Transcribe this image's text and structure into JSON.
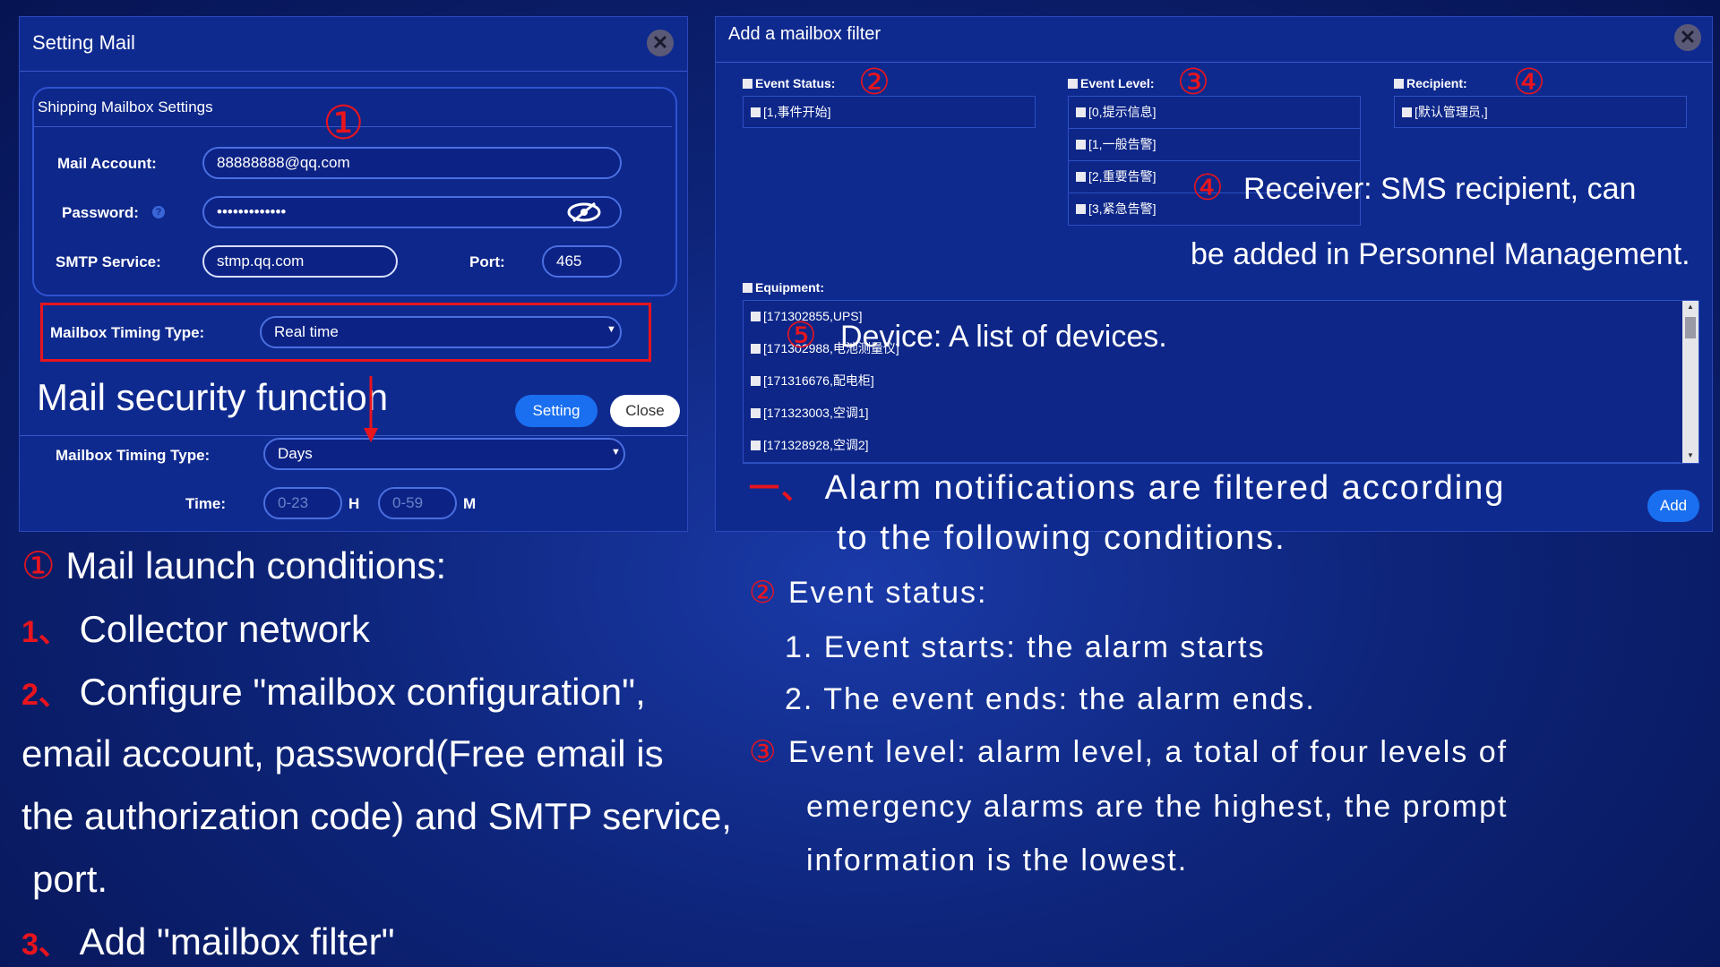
{
  "setting_mail": {
    "title": "Setting Mail",
    "section_title": "Shipping Mailbox Settings",
    "mail_account_label": "Mail Account:",
    "mail_account_value": "88888888@qq.com",
    "password_label": "Password:",
    "password_value": "•••••••••••••",
    "smtp_label": "SMTP Service:",
    "smtp_value": "stmp.qq.com",
    "port_label": "Port:",
    "port_value": "465",
    "timing_label": "Mailbox Timing Type:",
    "timing_value": "Real time",
    "setting_button": "Setting",
    "close_button": "Close",
    "timing2_label": "Mailbox Timing Type:",
    "timing2_value": "Days",
    "time_label": "Time:",
    "hour_placeholder": "0-23",
    "hour_unit": "H",
    "minute_placeholder": "0-59",
    "minute_unit": "M"
  },
  "filter": {
    "title": "Add a mailbox filter",
    "event_status_label": "Event Status:",
    "event_status_items": [
      "[1,事件开始]"
    ],
    "event_level_label": "Event Level:",
    "event_level_items": [
      "[0,提示信息]",
      "[1,一般告警]",
      "[2,重要告警]",
      "[3,紧急告警]"
    ],
    "recipient_label": "Recipient:",
    "recipient_items": [
      "[默认管理员,]"
    ],
    "equipment_label": "Equipment:",
    "equipment_items": [
      "[171302855,UPS]",
      "[171302988,电池测量仪]",
      "[171316676,配电柜]",
      "[171323003,空调1]",
      "[171328928,空调2]"
    ],
    "add_button": "Add"
  },
  "annotations": {
    "c1": "①",
    "c2": "②",
    "c3": "③",
    "c4": "④",
    "c5": "⑤",
    "mail_security": "Mail security function",
    "receiver_line1": "Receiver: SMS recipient, can",
    "receiver_line2": "be added in Personnel Management.",
    "device": "Device: A list of devices.",
    "launch_title": "Mail launch conditions:",
    "launch_1_mark": "1、",
    "launch_1": "Collector network",
    "launch_2_mark": "2、",
    "launch_2a": "Configure \"mailbox configuration\",",
    "launch_2b": "email account, password(Free email is",
    "launch_2c": "the authorization code) and SMTP service,",
    "launch_2d": "port.",
    "launch_3_mark": "3、",
    "launch_3": "Add \"mailbox filter\"",
    "alarm_mark": "一、",
    "alarm_line1": "Alarm notifications are filtered according",
    "alarm_line2": "to the following conditions.",
    "event_status_title": "Event status:",
    "event_status_1": "1. Event starts: the alarm starts",
    "event_status_2": "2. The event ends: the alarm ends.",
    "event_level_line1": "Event level: alarm level, a total of four levels of",
    "event_level_line2": "emergency alarms are the highest, the prompt",
    "event_level_line3": "information is the lowest."
  },
  "colors": {
    "accent_red": "#e8141e",
    "button_blue": "#1a6ff0",
    "panel_blue": "#0f2a8f"
  }
}
